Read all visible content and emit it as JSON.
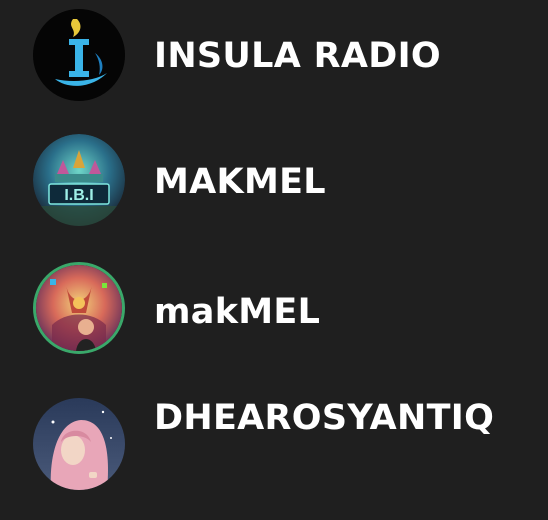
{
  "stations": [
    {
      "name": "INSULA RADIO",
      "avatar_icon": "insula-radio-logo-icon"
    },
    {
      "name": "MAKMEL",
      "avatar_icon": "ibi-palace-logo-icon"
    },
    {
      "name": "makMEL",
      "avatar_icon": "colorful-portrait-icon"
    },
    {
      "name": "DHEAROSYANTIQ",
      "avatar_icon": "hijab-portrait-icon"
    }
  ],
  "colors": {
    "background": "#1f1f1f",
    "text": "#ffffff",
    "insula_accent": "#3ab4e8",
    "insula_gold": "#e8c83a"
  }
}
